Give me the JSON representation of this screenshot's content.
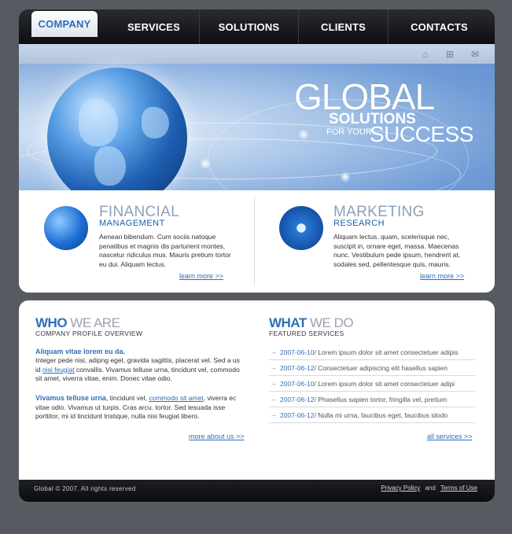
{
  "nav": {
    "items": [
      "COMPANY",
      "SERVICES",
      "SOLUTIONS",
      "CLIENTS",
      "CONTACTS"
    ],
    "active": "COMPANY"
  },
  "hero": {
    "icons": [
      "home-icon",
      "sitemap-icon",
      "mail-icon"
    ],
    "title_main": "GLOBAL",
    "title_solutions": "SOLUTIONS",
    "title_for_your": "FOR YOUR",
    "title_success": "SUCCESS"
  },
  "features": [
    {
      "title": "FINANCIAL",
      "subtitle": "MANAGEMENT",
      "text": "Aenean bibendum. Cum sociis natoque penatibus et magnis dis parturient montes, nascetur ridiculus mus. Mauris pretium tortor eu dui. Aliquam lectus.",
      "link": "learn more >>"
    },
    {
      "title": "MARKETING",
      "subtitle": "RESEARCH",
      "text": "Aliquam lectus. quam, scelerisque nec, suscipit in, ornare eget, massa. Maecenas nunc. Vestibulum pede ipsum, hendrerit at, sodales sed, pellentesque quis, mauris.",
      "link": "learn more >>"
    }
  ],
  "who": {
    "title_bold": "WHO",
    "title_light": "WE ARE",
    "subtitle": "COMPANY PROFILE OVERVIEW",
    "p1_title": "Aliquam vitae lorem eu da.",
    "p1_text_a": "Integer pede nisi, adipng eget, gravida sagittis, placerat vel. Sed a us id ",
    "p1_link": "nisi feugiat",
    "p1_text_b": " convallis. Vivamus telluse urna, tincidunt vel, commodo sit amet, viverra vitae, enim. Donec vitae odio.",
    "p2_title": "Vivamus telluse urna",
    "p2_text_a": ", tincidunt vel, ",
    "p2_link": "commodo sit amet",
    "p2_text_b": ", viverra ec vitae odio. Vivamus ut turpis. Cras arcu. tortor. Sed lesuada isse porttitor, mi id tincidunt tristique, nulla nisi feugiat libero.",
    "more": "more about us >>"
  },
  "what": {
    "title_bold": "WHAT",
    "title_light": "WE DO",
    "subtitle": "FEATURED SERVICES",
    "items": [
      {
        "date": "2007-06-10",
        "text": " / Lorem ipsum dolor sit amet consectetuer adipis"
      },
      {
        "date": "2007-06-12",
        "text": " / Consectetuer adipiscing elit hasellus sapien"
      },
      {
        "date": "2007-06-10",
        "text": " / Lorem ipsum dolor sit amet consectetuer adipi"
      },
      {
        "date": "2007-06-12",
        "text": " / Phasellus sapien tortor, fringilla vel, pretium"
      },
      {
        "date": "2007-06-12",
        "text": " / Nulla mi urna, faucibus eget, faucibus idodo"
      }
    ],
    "more": "all services >>"
  },
  "footer": {
    "copyright": "Global © 2007. All rights reserved",
    "privacy": "Privacy Policy",
    "and": "and",
    "terms": "Terms of Use"
  },
  "colors": {
    "accent": "#2f6fb6",
    "background": "#585a62",
    "nav": "#111214"
  }
}
